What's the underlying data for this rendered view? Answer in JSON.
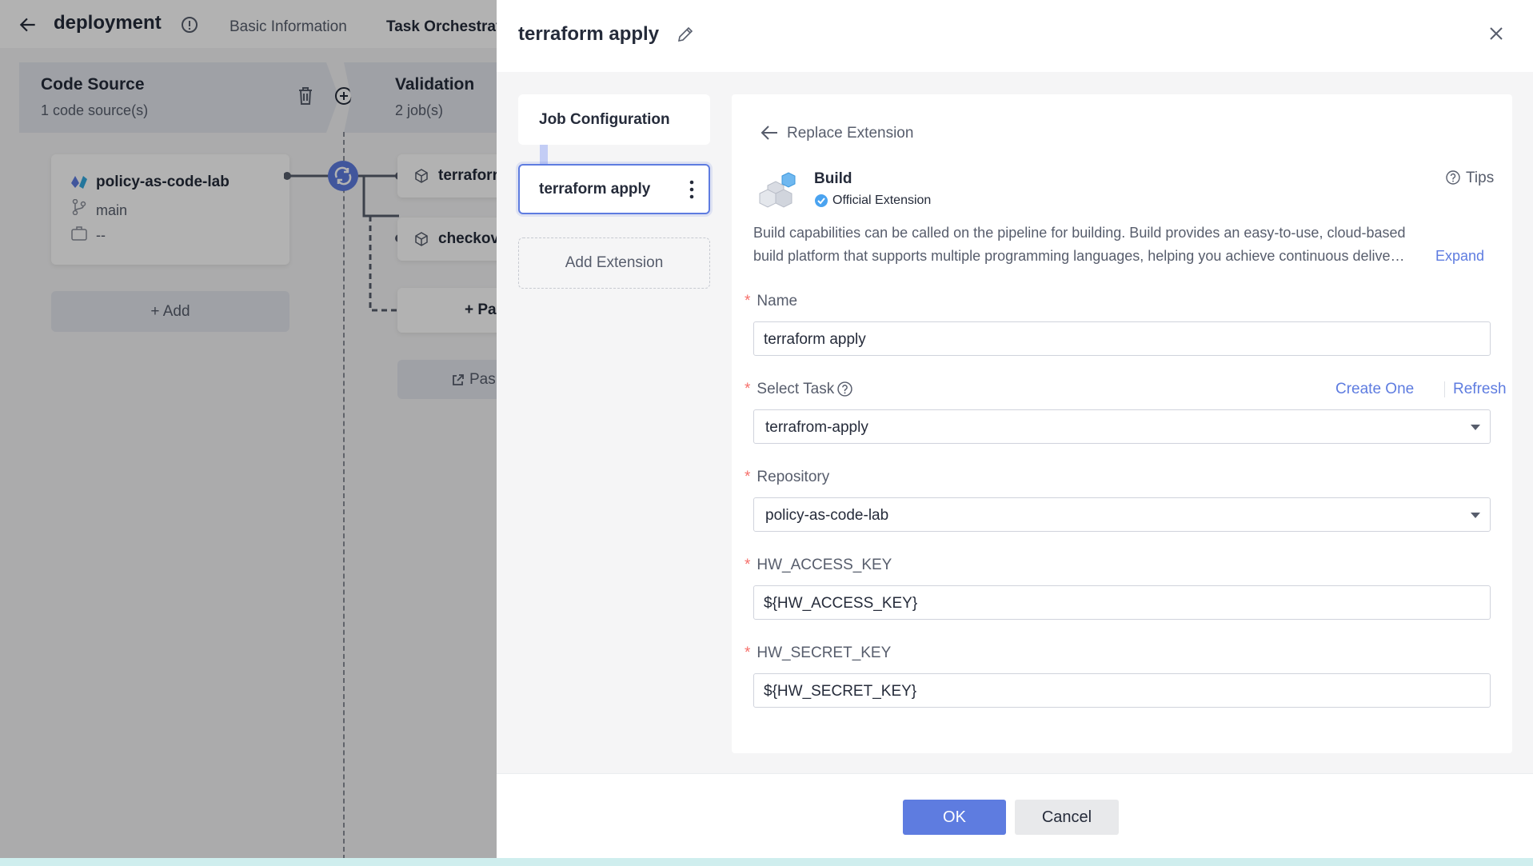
{
  "background": {
    "header": {
      "title": "deployment",
      "tabs": [
        "Basic Information",
        "Task Orchestrat"
      ]
    },
    "stages": [
      {
        "name": "Code Source",
        "sub": "1 code source(s)"
      },
      {
        "name": "Validation",
        "sub": "2 job(s)"
      }
    ],
    "source_card": {
      "repo": "policy-as-code-lab",
      "branch": "main",
      "env": "--"
    },
    "jobs": [
      "terraforr",
      "checkov"
    ],
    "add_button": "+ Add",
    "parallel_button": "+ Pa",
    "pass_button": "Pas"
  },
  "drawer": {
    "title": "terraform apply",
    "steps": {
      "job_config": "Job Configuration",
      "current": "terraform apply",
      "add_extension": "Add Extension"
    },
    "replace_extension": "Replace Extension",
    "extension": {
      "name": "Build",
      "badge": "Official Extension",
      "tips": "Tips",
      "description_line1": "Build capabilities can be called on the pipeline for building. Build provides an easy-to-use, cloud-based",
      "description_line2": "build platform that supports multiple programming languages, helping you achieve continuous delive…",
      "expand": "Expand"
    },
    "form": {
      "required_mark": "*",
      "name_label": "Name",
      "name_value": "terraform apply",
      "task_label": "Select Task",
      "task_value": "terrafrom-apply",
      "create_one": "Create One",
      "refresh": "Refresh",
      "repo_label": "Repository",
      "repo_value": "policy-as-code-lab",
      "ak_label": "HW_ACCESS_KEY",
      "ak_value": "${HW_ACCESS_KEY}",
      "sk_label": "HW_SECRET_KEY",
      "sk_value": "${HW_SECRET_KEY}"
    },
    "footer": {
      "ok": "OK",
      "cancel": "Cancel"
    }
  },
  "colors": {
    "accent": "#5e7ce0",
    "required": "#f66f6a",
    "overlay": "rgba(0,0,0,0.30)"
  }
}
